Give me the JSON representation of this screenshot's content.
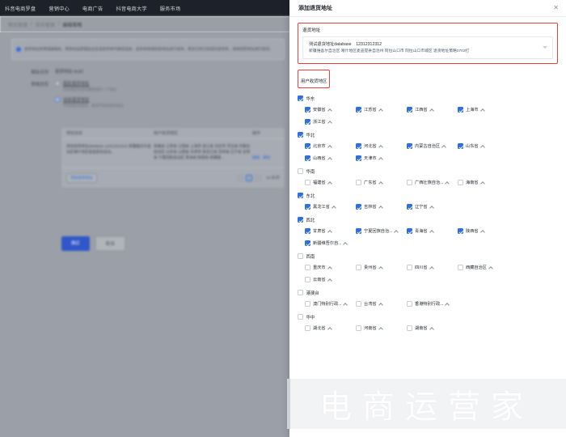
{
  "topnav": {
    "items": [
      {
        "label": "抖音电商罗盘"
      },
      {
        "label": "营销中心"
      },
      {
        "label": "电商广告"
      },
      {
        "label": "抖音电商大学"
      },
      {
        "label": "服务市场"
      }
    ],
    "icons": [
      {
        "name": "mobile-icon"
      },
      {
        "name": "message-icon"
      }
    ]
  },
  "breadcrumb": {
    "items": [
      "物流管理",
      "库存管理",
      "编辑策略"
    ],
    "separator": "/"
  },
  "alert": {
    "text": "退货地址新增或编辑后，需要商品管理后台生成退货单时重新选择，退货单将按照新地址进行退货，若您已有已完成的退货单，请按照原地址进行退货。"
  },
  "form": {
    "rows": [
      {
        "label": "模板名称",
        "value": "退货地址-test2",
        "type": "text"
      }
    ],
    "strategy_label": "策略类型",
    "options": [
      {
        "label": "固定退货地址",
        "hint": "所有地区的退货都使用同一个地址",
        "selected": false
      },
      {
        "label": "动态退货地址",
        "hint": "不同地区的退货，使用不同的退货地址",
        "selected": true
      }
    ]
  },
  "table": {
    "columns": [
      "退货地址",
      "地址信息",
      "用户收货地区",
      "操作"
    ],
    "rows": [
      {
        "address_info": "测试退货地址database  12312312312\n新疆维吾尔自治区喀什地区麦盖提县自治。",
        "regions": "安徽省  江苏省  江西省  上海市  浙江省  北京市  河北省  内蒙古自治区  山东省  山西省  天津市  黑龙江省  吉林省  辽宁省  甘肃省  宁夏回族自治区  青海省  陕西省  新疆维...",
        "actions": [
          "编辑",
          "删除"
        ]
      }
    ],
    "add_button": "添加退货地址",
    "pagination": {
      "prev": "‹",
      "current": "1",
      "next": "›",
      "page_size": "10 条/页"
    }
  },
  "footer_buttons": {
    "confirm": "确定",
    "cancel": "取消"
  },
  "modal": {
    "title": "添加退货地址",
    "close_icon": "close-icon",
    "address_section": {
      "label": "退货地址",
      "selected_name": "测试退货地址database",
      "selected_phone": "12312312312",
      "selected_detail": "新疆维吾尔自治区 喀什地区麦盖提县自治州 阿拉山口市 阿拉山口市城区 退货地址策略0703打"
    },
    "region_section": {
      "label": "用户收货地区",
      "groups": [
        {
          "name": "华东",
          "checked": true,
          "provinces": [
            {
              "name": "安徽省",
              "checked": true
            },
            {
              "name": "江苏省",
              "checked": true
            },
            {
              "name": "江西省",
              "checked": true
            },
            {
              "name": "上海市",
              "checked": true
            },
            {
              "name": "浙江省",
              "checked": true
            }
          ]
        },
        {
          "name": "华北",
          "checked": true,
          "provinces": [
            {
              "name": "北京市",
              "checked": true
            },
            {
              "name": "河北省",
              "checked": true
            },
            {
              "name": "内蒙古自治区",
              "checked": true
            },
            {
              "name": "山东省",
              "checked": true
            },
            {
              "name": "山西省",
              "checked": true
            },
            {
              "name": "天津市",
              "checked": true
            }
          ]
        },
        {
          "name": "华南",
          "checked": false,
          "provinces": [
            {
              "name": "福建省",
              "checked": false
            },
            {
              "name": "广东省",
              "checked": false
            },
            {
              "name": "广西壮族自治...",
              "checked": false
            },
            {
              "name": "海南省",
              "checked": false
            }
          ]
        },
        {
          "name": "东北",
          "checked": true,
          "provinces": [
            {
              "name": "黑龙江省",
              "checked": true
            },
            {
              "name": "吉林省",
              "checked": true
            },
            {
              "name": "辽宁省",
              "checked": true
            }
          ]
        },
        {
          "name": "西北",
          "checked": true,
          "provinces": [
            {
              "name": "甘肃省",
              "checked": true
            },
            {
              "name": "宁夏回族自治...",
              "checked": true
            },
            {
              "name": "青海省",
              "checked": true
            },
            {
              "name": "陕西省",
              "checked": true
            },
            {
              "name": "新疆维吾尔自...",
              "checked": true
            }
          ]
        },
        {
          "name": "西南",
          "checked": false,
          "provinces": [
            {
              "name": "重庆市",
              "checked": false
            },
            {
              "name": "贵州省",
              "checked": false
            },
            {
              "name": "四川省",
              "checked": false
            },
            {
              "name": "西藏自治区",
              "checked": false
            },
            {
              "name": "云南省",
              "checked": false
            }
          ]
        },
        {
          "name": "港澳台",
          "checked": false,
          "provinces": [
            {
              "name": "澳门特别行政...",
              "checked": false
            },
            {
              "name": "台湾省",
              "checked": false
            },
            {
              "name": "香港特别行政...",
              "checked": false
            }
          ]
        },
        {
          "name": "华中",
          "checked": false,
          "provinces": [
            {
              "name": "湖北省",
              "checked": false
            },
            {
              "name": "河南省",
              "checked": false
            },
            {
              "name": "湖南省",
              "checked": false
            }
          ]
        }
      ]
    }
  },
  "watermark": {
    "text": "电商运营家"
  },
  "colors": {
    "accent": "#2f6fe0",
    "nav_bg": "#1d2129",
    "highlight_border": "#e8413a",
    "primary_button": "#2f57c9"
  }
}
